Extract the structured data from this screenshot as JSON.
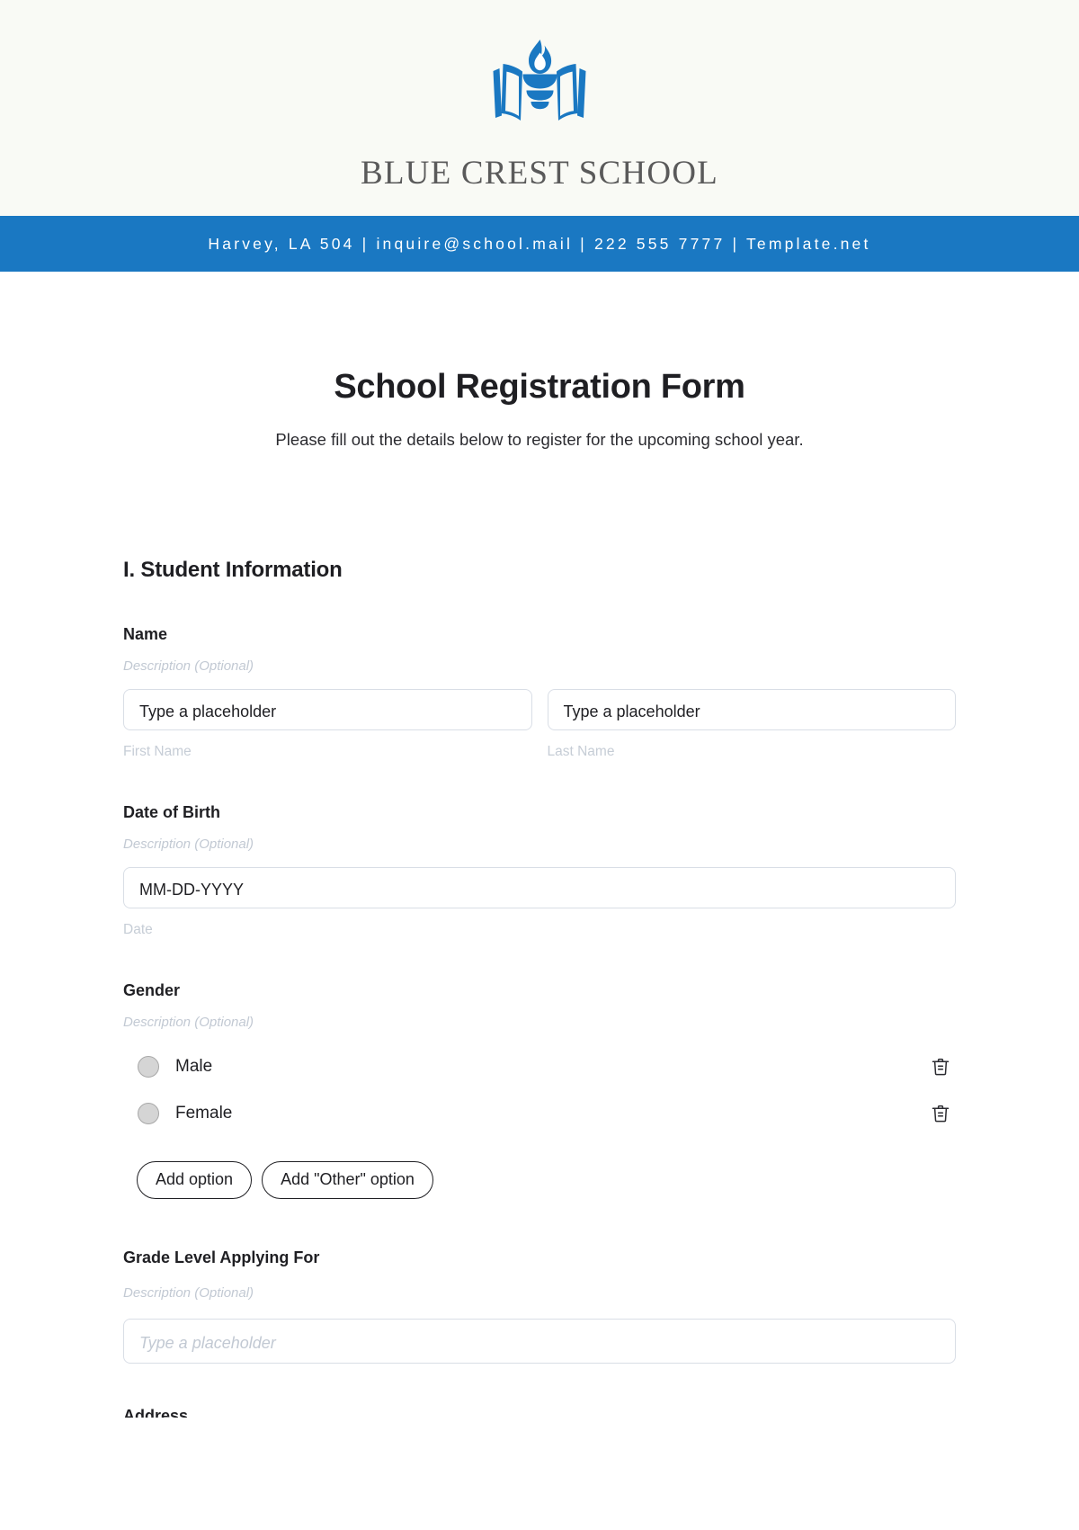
{
  "letterhead": {
    "logo_icon": "book-flame-logo-icon",
    "school_name": "BLUE CREST SCHOOL",
    "background_color": "#f9faf5",
    "logo_color": "#1a78c2",
    "school_name_color": "#5a5a5a"
  },
  "contact_bar": {
    "text": "Harvey, LA 504 | inquire@school.mail | 222 555 7777 | Template.net",
    "background_color": "#1a78c2",
    "text_color": "#ffffff"
  },
  "form": {
    "title": "School Registration Form",
    "subtitle": "Please fill out the details below to register for the upcoming school year.",
    "section": {
      "heading": "I. Student Information"
    },
    "fields": [
      {
        "label": "Name",
        "description": "Description (Optional)",
        "inputs": [
          {
            "value": "Type a placeholder",
            "sub_label": "First Name"
          },
          {
            "value": "Type a placeholder",
            "sub_label": "Last Name"
          }
        ]
      },
      {
        "label": "Date of Birth",
        "description": "Description (Optional)",
        "inputs": [
          {
            "value": "MM-DD-YYYY",
            "sub_label": "Date"
          }
        ]
      },
      {
        "label": "Gender",
        "description": "Description (Optional)",
        "options": [
          {
            "label": "Male",
            "delete_icon": "trash-icon"
          },
          {
            "label": "Female",
            "delete_icon": "trash-icon"
          }
        ],
        "buttons": [
          {
            "label": "Add option"
          },
          {
            "label": "Add \"Other\" option"
          }
        ]
      },
      {
        "label": "Grade Level Applying For",
        "description": "Description (Optional)",
        "placeholder": "Type a placeholder"
      },
      {
        "label": "Address"
      }
    ]
  },
  "colors": {
    "accent": "#1a78c2",
    "text": "#1f1f23",
    "muted": "#c2c9d3",
    "border": "#d9dee6"
  }
}
